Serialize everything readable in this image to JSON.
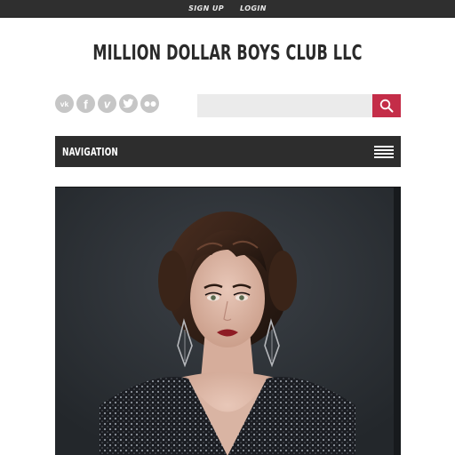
{
  "topbar": {
    "signup_label": "SIGN UP",
    "login_label": "LOGIN"
  },
  "site": {
    "title": "MILLION DOLLAR BOYS CLUB LLC"
  },
  "social": {
    "icons": [
      "vk-icon",
      "facebook-icon",
      "vimeo-icon",
      "twitter-icon",
      "flickr-icon"
    ]
  },
  "search": {
    "placeholder": "",
    "value": ""
  },
  "nav": {
    "label": "NAVIGATION"
  },
  "colors": {
    "topbar_bg": "#2f2f2f",
    "nav_bg": "#2d2d2d",
    "accent": "#c42d48",
    "social_icon_bg": "#c6c6c6",
    "search_bg": "#ebebeb"
  },
  "hero": {
    "image": "portrait-woman-finger-waves-sequin-dress"
  }
}
